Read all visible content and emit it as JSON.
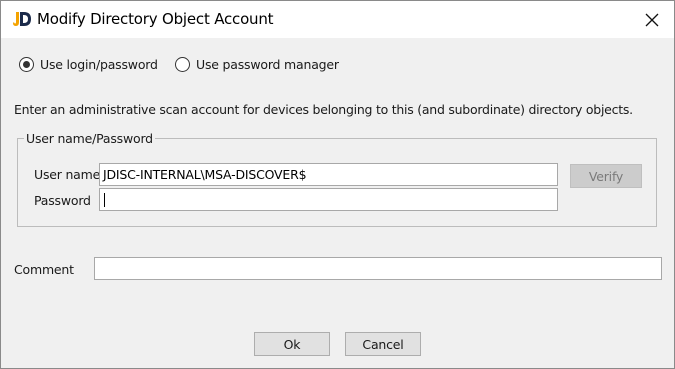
{
  "window": {
    "title": "Modify Directory Object Account"
  },
  "account_type": {
    "options": [
      {
        "label": "Use login/password",
        "selected": true
      },
      {
        "label": "Use password manager",
        "selected": false
      }
    ]
  },
  "intro_text": "Enter an administrative scan account for devices belonging to this (and subordinate) directory objects.",
  "credentials": {
    "group_title": "User name/Password",
    "username_label": "User name",
    "username_value": "JDISC-INTERNAL\\MSA-DISCOVER$",
    "password_label": "Password",
    "password_value": "",
    "verify_label": "Verify"
  },
  "comment": {
    "label": "Comment",
    "value": ""
  },
  "buttons": {
    "ok": "Ok",
    "cancel": "Cancel"
  },
  "colors": {
    "logo_j": "#f4a300",
    "logo_d": "#1b2a4a"
  }
}
